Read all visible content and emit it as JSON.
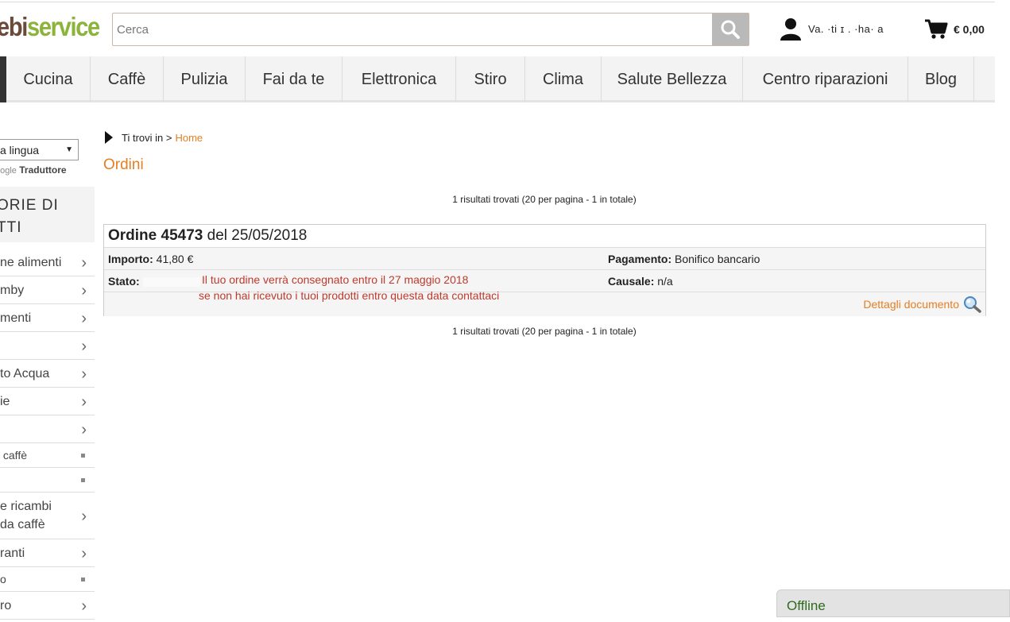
{
  "header": {
    "logo_part1": "ebi",
    "logo_part2": "service",
    "search_placeholder": "Cerca",
    "user_name": "Va.  ·ti   ɪ .     ·ha·   a",
    "cart_total": "€ 0,00"
  },
  "nav": {
    "items": [
      {
        "label": "Cucina",
        "width": 106
      },
      {
        "label": "Caffè",
        "width": 92
      },
      {
        "label": "Pulizia",
        "width": 103
      },
      {
        "label": "Fai da te",
        "width": 122
      },
      {
        "label": "Elettronica",
        "width": 143
      },
      {
        "label": "Stiro",
        "width": 87
      },
      {
        "label": "Clima",
        "width": 96
      },
      {
        "label": "Salute Bellezza",
        "width": 178
      },
      {
        "label": "Centro riparazioni",
        "width": 208
      },
      {
        "label": "Blog",
        "width": 83
      }
    ]
  },
  "sidebar": {
    "language_select": "a lingua",
    "google_label": "oogle",
    "translate_label": "Traduttore",
    "title_line1": "ORIE DI",
    "title_line2": "TTI",
    "items": [
      {
        "label": "ne alimenti",
        "type": "chevron"
      },
      {
        "label": "mby",
        "type": "chevron"
      },
      {
        "label": "menti",
        "type": "chevron"
      },
      {
        "label": "",
        "type": "chevron"
      },
      {
        "label": "to Acqua",
        "type": "chevron"
      },
      {
        "label": "ie",
        "type": "chevron"
      },
      {
        "label": "",
        "type": "chevron"
      },
      {
        "label": " caffè",
        "type": "square"
      },
      {
        "label": "",
        "type": "square"
      },
      {
        "label": "e ricambi\nda caffè",
        "type": "chevron"
      },
      {
        "label": "ranti",
        "type": "chevron"
      },
      {
        "label": "o",
        "type": "square"
      },
      {
        "label": "ro",
        "type": "chevron"
      }
    ]
  },
  "main": {
    "breadcrumb_prefix": "Ti trovi in >",
    "breadcrumb_home": "Home",
    "page_title": "Ordini",
    "results_text": "1 risultati trovati (20 per pagina - 1 in totale)",
    "order": {
      "title_bold": "Ordine 45473",
      "title_rest": " del 25/05/2018",
      "importo_label": "Importo:",
      "importo_value": " 41,80 €",
      "pagamento_label": "Pagamento:",
      "pagamento_value": " Bonifico bancario",
      "stato_label": "Stato:",
      "causale_label": "Causale:",
      "causale_value": " n/a",
      "note_line1": "Il tuo ordine verrà consegnato entro il 27 maggio 2018",
      "note_line2": "se non hai ricevuto i tuoi prodotti entro questa data contattaci",
      "details_link": "Dettagli documento"
    }
  },
  "chat": {
    "status": "Offline"
  }
}
